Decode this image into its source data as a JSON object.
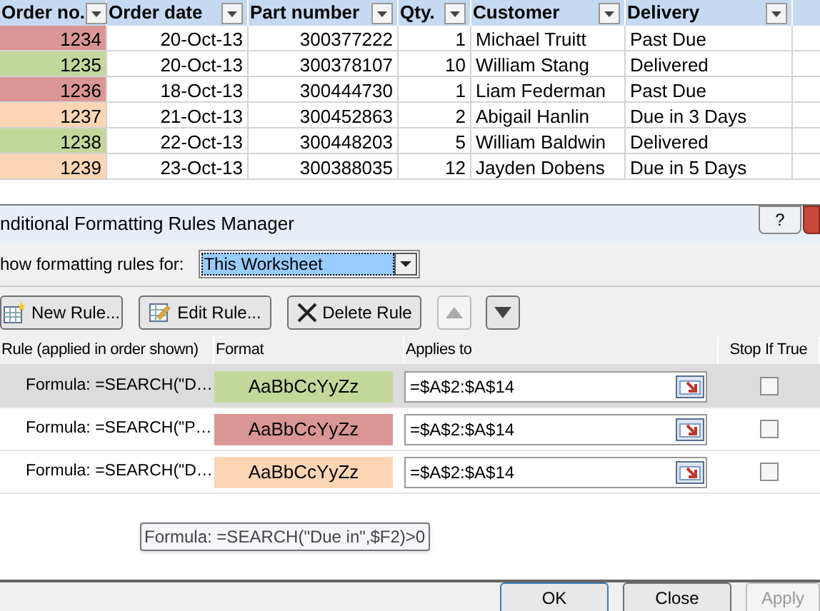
{
  "sheet": {
    "columns": [
      {
        "label": "Order no."
      },
      {
        "label": "Order date"
      },
      {
        "label": "Part number"
      },
      {
        "label": "Qty."
      },
      {
        "label": "Customer"
      },
      {
        "label": "Delivery"
      }
    ],
    "rows": [
      {
        "order_no": "1234",
        "color": "#da9694",
        "order_date": "20-Oct-13",
        "part_number": "300377222",
        "qty": "1",
        "customer": "Michael Truitt",
        "delivery": "Past Due"
      },
      {
        "order_no": "1235",
        "color": "#c4d79b",
        "order_date": "20-Oct-13",
        "part_number": "300378107",
        "qty": "10",
        "customer": "William Stang",
        "delivery": "Delivered"
      },
      {
        "order_no": "1236",
        "color": "#da9694",
        "order_date": "18-Oct-13",
        "part_number": "300444730",
        "qty": "1",
        "customer": "Liam Federman",
        "delivery": "Past Due"
      },
      {
        "order_no": "1237",
        "color": "#fcd5b4",
        "order_date": "21-Oct-13",
        "part_number": "300452863",
        "qty": "2",
        "customer": "Abigail Hanlin",
        "delivery": "Due in 3 Days"
      },
      {
        "order_no": "1238",
        "color": "#c4d79b",
        "order_date": "22-Oct-13",
        "part_number": "300448203",
        "qty": "5",
        "customer": "William Baldwin",
        "delivery": "Delivered"
      },
      {
        "order_no": "1239",
        "color": "#fcd5b4",
        "order_date": "23-Oct-13",
        "part_number": "300388035",
        "qty": "12",
        "customer": "Jayden Dobens",
        "delivery": "Due in 5 Days"
      }
    ]
  },
  "dialog": {
    "title": "nditional Formatting Rules Manager",
    "help": "?",
    "show_rules_label": "how formatting rules for:",
    "show_rules_value": "This Worksheet",
    "toolbar": [
      {
        "kind": "new",
        "label": "New Rule...",
        "disabled": false
      },
      {
        "kind": "edit",
        "label": "Edit Rule...",
        "disabled": false
      },
      {
        "kind": "delete",
        "label": "Delete Rule",
        "disabled": false
      },
      {
        "kind": "up",
        "disabled": true
      },
      {
        "kind": "down",
        "disabled": false
      }
    ],
    "columns": [
      {
        "label": "Rule (applied in order shown)"
      },
      {
        "label": "Format"
      },
      {
        "label": "Applies to"
      },
      {
        "label": "Stop If True"
      }
    ],
    "rules": [
      {
        "rule": "Formula: =SEARCH(\"D…",
        "preview": "AaBbCcYyZz",
        "color": "#c4d79b",
        "applies_to": "=$A$2:$A$14",
        "stop_if_true": false,
        "selected": true
      },
      {
        "rule": "Formula: =SEARCH(\"P…",
        "preview": "AaBbCcYyZz",
        "color": "#da9694",
        "applies_to": "=$A$2:$A$14",
        "stop_if_true": false,
        "selected": false
      },
      {
        "rule": "Formula: =SEARCH(\"D…",
        "preview": "AaBbCcYyZz",
        "color": "#fcd5b4",
        "applies_to": "=$A$2:$A$14",
        "stop_if_true": false,
        "selected": false
      }
    ],
    "tooltip": "Formula: =SEARCH(\"Due in\",$F2)>0",
    "buttons": [
      {
        "label": "OK",
        "disabled": false,
        "default": true
      },
      {
        "label": "Close",
        "disabled": false,
        "default": false
      },
      {
        "label": "Apply",
        "disabled": true,
        "default": false
      }
    ]
  }
}
